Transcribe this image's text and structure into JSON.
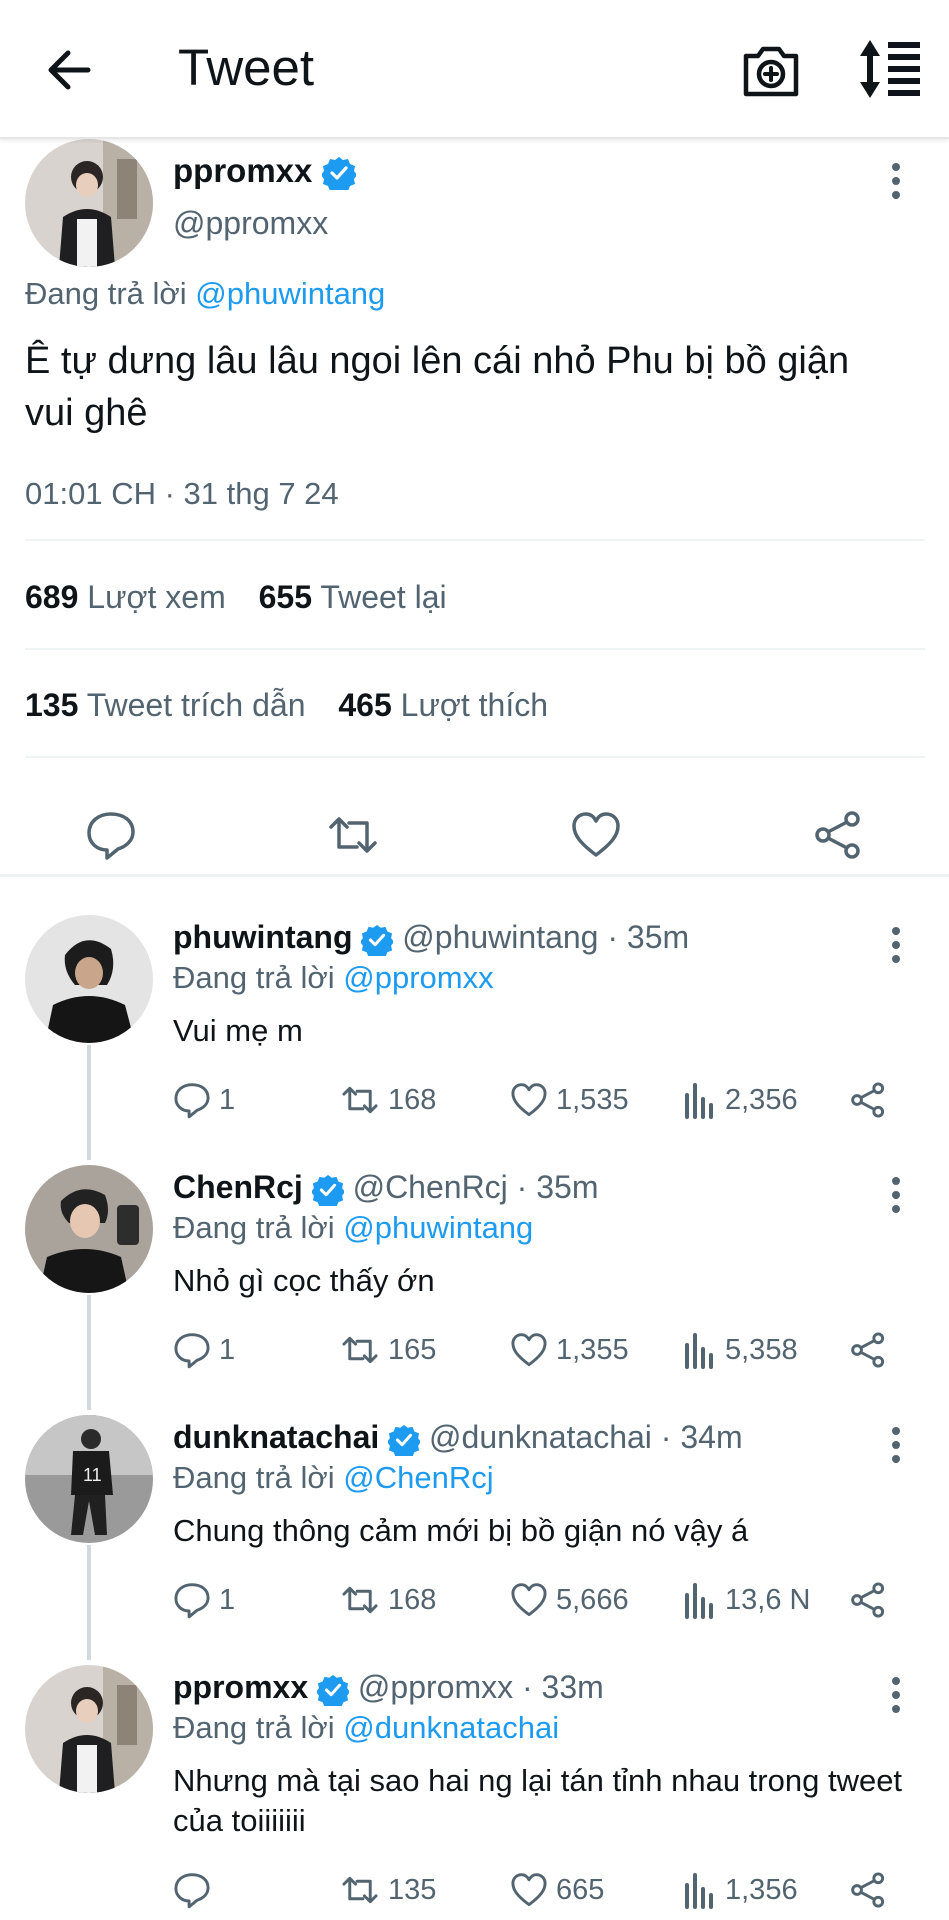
{
  "header": {
    "title": "Tweet",
    "back_icon": "arrow-left-icon",
    "camera_icon": "camera-plus-icon",
    "sort_icon": "sort-icon"
  },
  "colors": {
    "accent": "#1d9bf0",
    "text": "#0f1419",
    "muted": "#536471",
    "divider": "#eff3f4"
  },
  "main_tweet": {
    "display_name": "ppromxx",
    "handle": "@ppromxx",
    "replying_prefix": "Đang trả lời",
    "replying_to": "@phuwintang",
    "text": "Ê tự dưng lâu lâu ngoi lên cái nhỏ Phu bị bồ giận vui ghê",
    "timestamp": "01:01 CH · 31 thg 7 24",
    "stats": {
      "views_count": "689",
      "views_label": "Lượt xem",
      "retweets_count": "655",
      "retweets_label": "Tweet lại",
      "quotes_count": "135",
      "quotes_label": "Tweet trích dẫn",
      "likes_count": "465",
      "likes_label": "Lượt thích"
    }
  },
  "replies": [
    {
      "display_name": "phuwintang",
      "handle": "@phuwintang · 35m",
      "replying_prefix": "Đang trả lời",
      "replying_to": "@ppromxx",
      "text": "Vui mẹ m",
      "reply_count": "1",
      "retweet_count": "168",
      "like_count": "1,535",
      "view_count": "2,356"
    },
    {
      "display_name": "ChenRcj",
      "handle": "@ChenRcj · 35m",
      "replying_prefix": "Đang trả lời",
      "replying_to": "@phuwintang",
      "text": "Nhỏ gì cọc thấy ớn",
      "reply_count": "1",
      "retweet_count": "165",
      "like_count": "1,355",
      "view_count": "5,358"
    },
    {
      "display_name": "dunknatachai",
      "handle": "@dunknatachai · 34m",
      "replying_prefix": "Đang trả lời",
      "replying_to": "@ChenRcj",
      "text": "Chung thông cảm mới bị bồ giận nó vậy á",
      "reply_count": "1",
      "retweet_count": "168",
      "like_count": "5,666",
      "view_count": "13,6 N"
    },
    {
      "display_name": "ppromxx",
      "handle": "@ppromxx · 33m",
      "replying_prefix": "Đang trả lời",
      "replying_to": "@dunknatachai",
      "text": "Nhưng mà tại sao hai ng lại tán tỉnh nhau trong tweet của toiiiiiii",
      "reply_count": "",
      "retweet_count": "135",
      "like_count": "665",
      "view_count": "1,356"
    }
  ]
}
